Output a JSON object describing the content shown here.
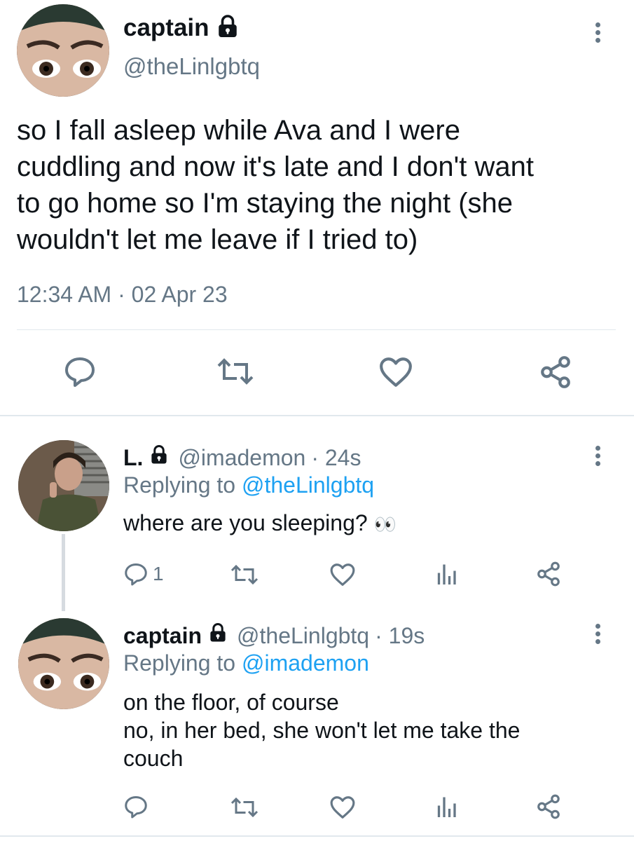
{
  "main_tweet": {
    "display_name": "captain",
    "handle": "@theLinlgbtq",
    "text_lines": [
      "so I fall asleep while Ava and I were",
      "cuddling and now it's late and I don't want",
      "to go home so I'm staying the night (she",
      "wouldn't let me leave if I tried to)"
    ],
    "timestamp": "12:34 AM · 02 Apr 23"
  },
  "reply_1": {
    "display_name": "L.",
    "handle": "@imademon",
    "age": "· 24s",
    "replying_prefix": "Replying to",
    "replying_to": "@theLinlgbtq",
    "text": "where are you sleeping?",
    "emoji": "👀",
    "reply_count": "1"
  },
  "reply_2": {
    "display_name": "captain",
    "handle": "@theLinlgbtq",
    "age": "· 19s",
    "replying_prefix": "Replying to",
    "replying_to": "@imademon",
    "text_lines": [
      "on the floor, of course",
      "no, in her bed, she won't let me take the",
      "couch"
    ]
  },
  "icons": {
    "lock": "lock-icon",
    "more": "more-vertical-icon",
    "reply": "reply-icon",
    "retweet": "retweet-icon",
    "like": "heart-icon",
    "share": "share-icon",
    "stats": "analytics-icon"
  },
  "colors": {
    "text": "#0f1419",
    "muted": "#657786",
    "link": "#1da1f2",
    "divider": "#e1e8ed"
  }
}
